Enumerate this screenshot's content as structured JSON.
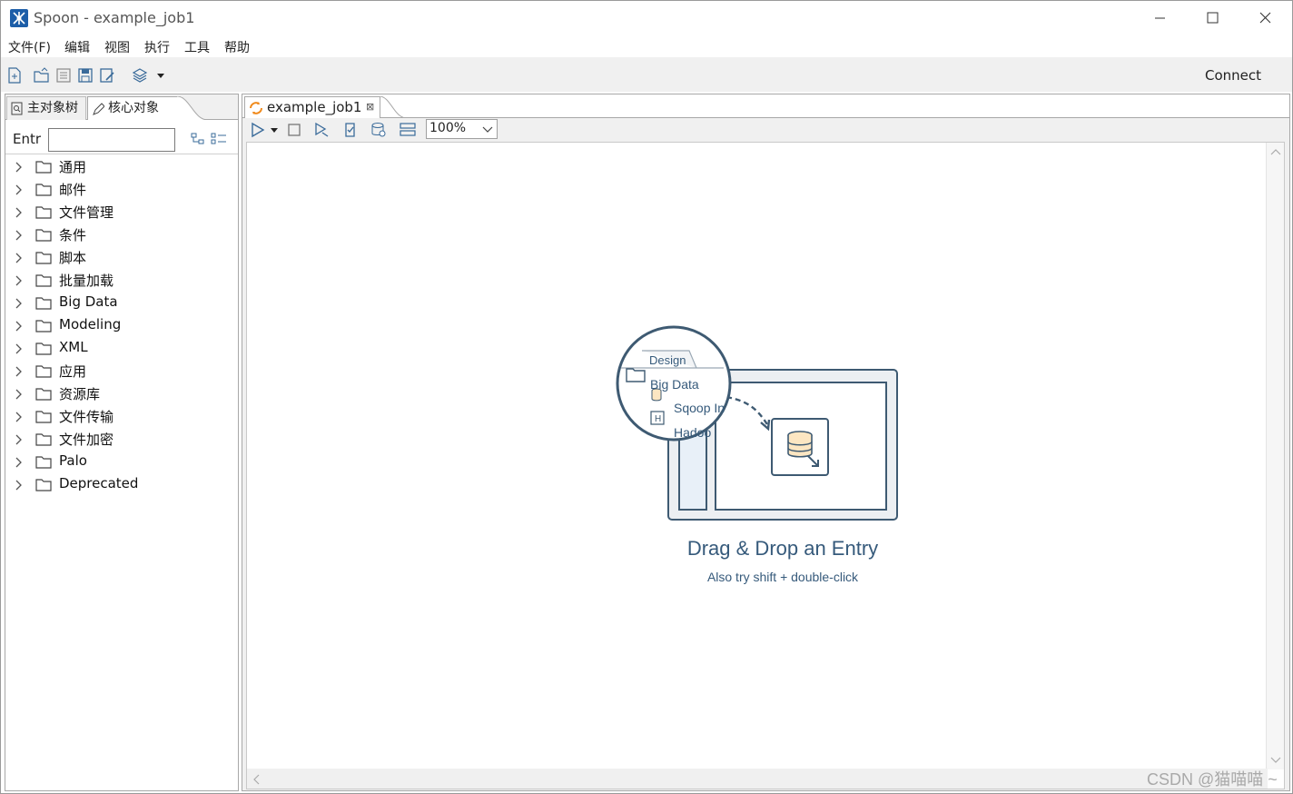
{
  "window": {
    "title": "Spoon - example_job1"
  },
  "menu": [
    "文件(F)",
    "编辑",
    "视图",
    "执行",
    "工具",
    "帮助"
  ],
  "toolbar": {
    "connect_label": "Connect"
  },
  "left_panel": {
    "tabs": [
      "主对象树",
      "核心对象"
    ],
    "search_label": "Entr",
    "search_value": "",
    "tree": [
      "通用",
      "邮件",
      "文件管理",
      "条件",
      "脚本",
      "批量加载",
      "Big Data",
      "Modeling",
      "XML",
      "应用",
      "资源库",
      "文件传输",
      "文件加密",
      "Palo",
      "Deprecated"
    ]
  },
  "editor": {
    "tab_label": "example_job1",
    "zoom": "100%",
    "illustration": {
      "design_tab": "Design",
      "folder_label": "Big Data",
      "item1": "Sqoop In",
      "item2": "Hadoo"
    },
    "drag_drop_title": "Drag & Drop an Entry",
    "drag_drop_hint": "Also try shift + double-click"
  },
  "watermark": "CSDN @猫喵喵 ~",
  "colors": {
    "app_icon": "#1d5ea8",
    "illustration_stroke": "#3e5a72",
    "illustration_text": "#365a7b",
    "db_fill": "#fce6c2"
  }
}
